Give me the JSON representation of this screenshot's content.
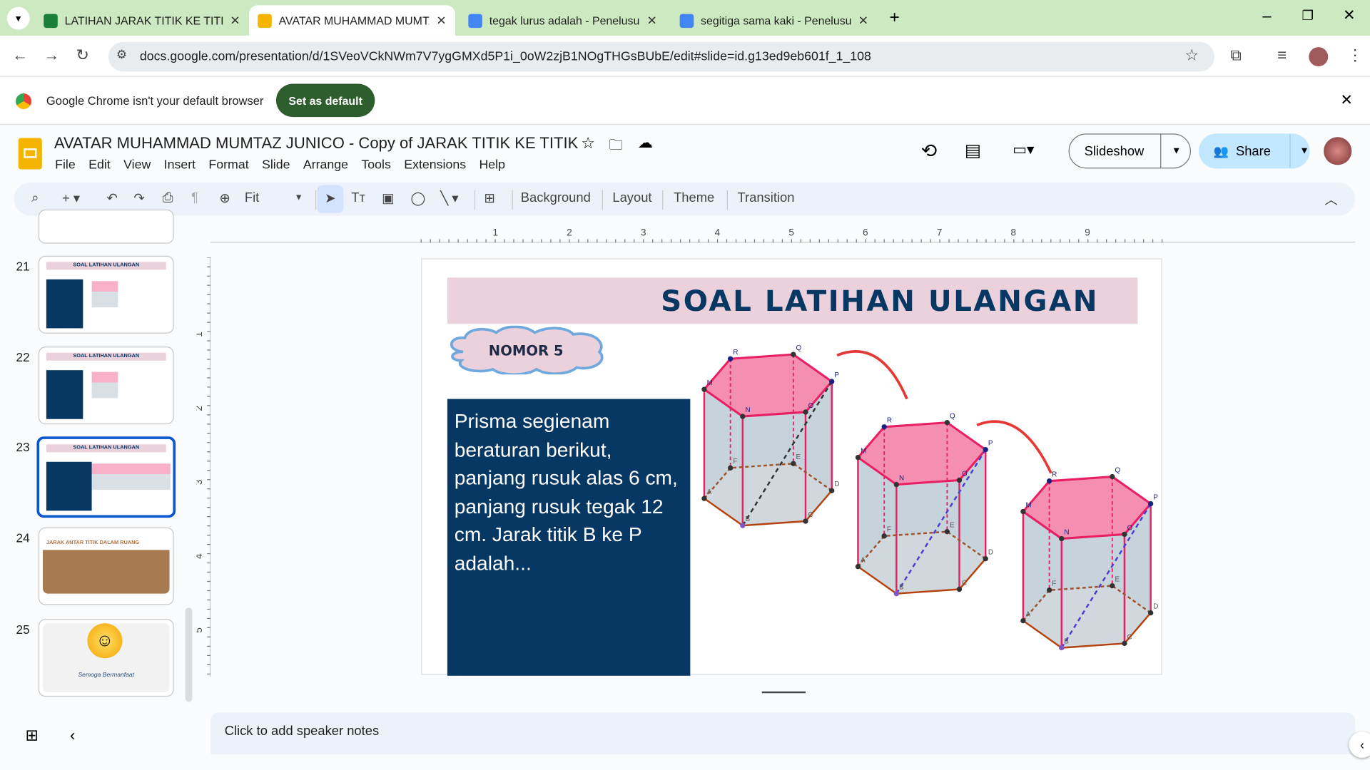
{
  "browser": {
    "tabs": [
      {
        "title": "LATIHAN JARAK TITIK KE TITIK",
        "icon": "sheets-icon",
        "color": "#188038"
      },
      {
        "title": "AVATAR MUHAMMAD MUMTAZ",
        "icon": "slides-icon",
        "color": "#f4b400",
        "active": true
      },
      {
        "title": "tegak lurus adalah - Penelusura",
        "icon": "google-icon",
        "color": "#4285f4"
      },
      {
        "title": "segitiga sama kaki - Penelusura",
        "icon": "google-icon",
        "color": "#4285f4"
      }
    ],
    "url": "docs.google.com/presentation/d/1SVeoVCkNWm7V7ygGMXd5P1i_0oW2zjB1NOgTHGsBUbE/edit#slide=id.g13ed9eb601f_1_108",
    "infobar": {
      "message": "Google Chrome isn't your default browser",
      "button": "Set as default"
    }
  },
  "app": {
    "doc_title": "AVATAR MUHAMMAD MUMTAZ JUNICO - Copy of JARAK TITIK KE TITIK",
    "menu": [
      "File",
      "Edit",
      "View",
      "Insert",
      "Format",
      "Slide",
      "Arrange",
      "Tools",
      "Extensions",
      "Help"
    ],
    "slideshow": "Slideshow",
    "share": "Share",
    "toolbar": {
      "zoom": "Fit",
      "background": "Background",
      "layout": "Layout",
      "theme": "Theme",
      "transition": "Transition"
    },
    "ruler_h": [
      "1",
      "2",
      "3",
      "4",
      "5",
      "6",
      "7",
      "8",
      "9"
    ],
    "ruler_v": [
      "1",
      "2",
      "3",
      "4",
      "5"
    ],
    "notes_placeholder": "Click to add speaker notes"
  },
  "thumbnails": [
    {
      "num": "21",
      "title": "SOAL LATIHAN ULANGAN"
    },
    {
      "num": "22",
      "title": "SOAL LATIHAN ULANGAN"
    },
    {
      "num": "23",
      "title": "SOAL LATIHAN ULANGAN",
      "selected": true
    },
    {
      "num": "24",
      "title": "JARAK ANTAR TITIK DALAM RUANG"
    },
    {
      "num": "25",
      "caption": "Semoga Bermanfaat"
    }
  ],
  "slide": {
    "title": "SOAL LATIHAN ULANGAN",
    "badge": "NOMOR 5",
    "question": "Prisma segienam beraturan berikut, panjang rusuk alas 6 cm, panjang rusuk tegak 12 cm. Jarak titik B ke P adalah...",
    "vertex_labels": {
      "top": [
        "R",
        "Q",
        "P",
        "O",
        "N",
        "M"
      ],
      "bottom": [
        "F",
        "E",
        "D",
        "C",
        "B",
        "A"
      ]
    },
    "colors": {
      "title_bg": "#ead1dc",
      "title_text": "#073763",
      "question_bg": "#073763",
      "top_face": "#f48fb1",
      "edge": "#e91e63"
    }
  }
}
